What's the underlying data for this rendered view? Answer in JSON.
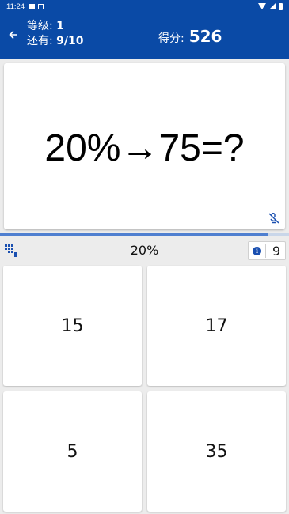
{
  "status_bar": {
    "time": "11:24"
  },
  "header": {
    "level_label": "等级:",
    "level_value": "1",
    "remaining_label": "还有:",
    "remaining_value": "9/10",
    "score_label": "得分:",
    "score_value": "526"
  },
  "question": {
    "text": "20%→75=?"
  },
  "progress": {
    "fraction": 0.93
  },
  "info_row": {
    "hint": "20%",
    "count": "9"
  },
  "answers": [
    "15",
    "17",
    "5",
    "35"
  ],
  "colors": {
    "primary": "#0a4aa6",
    "background": "#ececec",
    "progress": "#4f7fd0"
  },
  "icons": {
    "back": "arrow-back-icon",
    "sound": "sound-off-icon",
    "grid": "grid-icon",
    "info": "info-icon"
  }
}
